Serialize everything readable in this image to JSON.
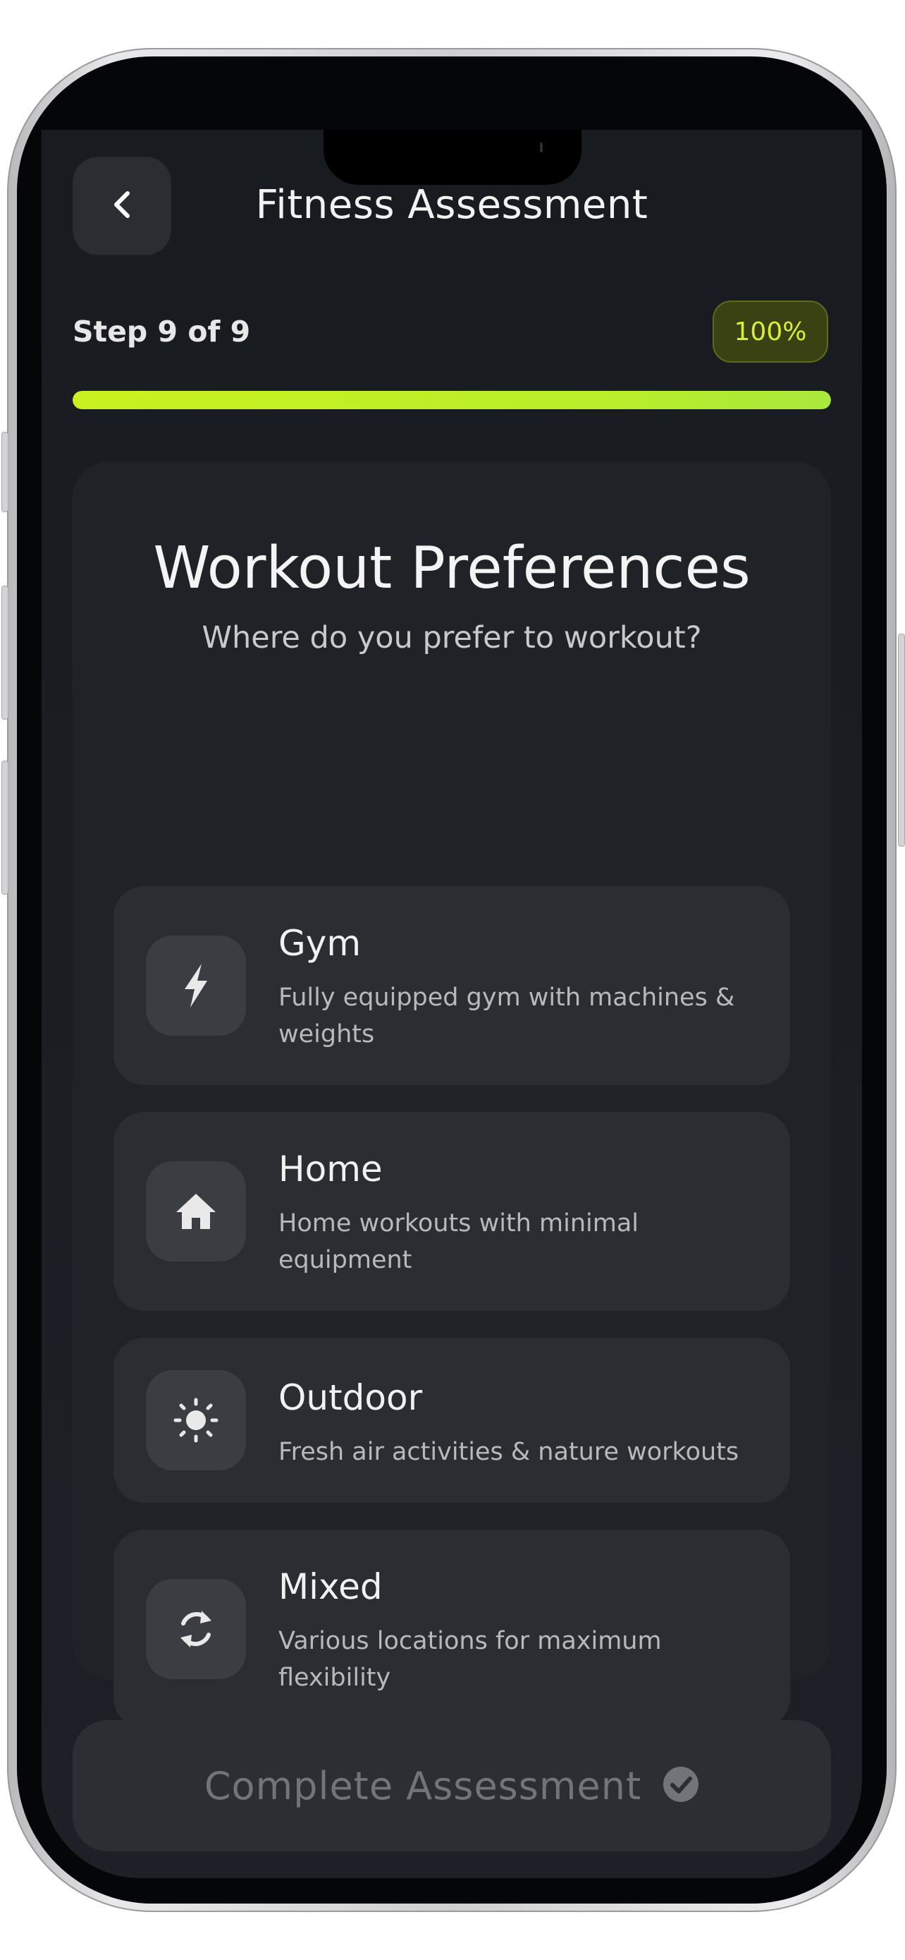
{
  "header": {
    "title": "Fitness Assessment",
    "back_icon": "chevron-left-icon"
  },
  "progress": {
    "step_label": "Step 9 of 9",
    "percent_label": "100%",
    "percent_value": 100
  },
  "card": {
    "title": "Workout Preferences",
    "subtitle": "Where do you prefer to workout?"
  },
  "options": [
    {
      "icon": "lightning-bolt-icon",
      "title": "Gym",
      "description": "Fully equipped gym with machines & weights"
    },
    {
      "icon": "home-icon",
      "title": "Home",
      "description": "Home workouts with minimal equipment"
    },
    {
      "icon": "sun-icon",
      "title": "Outdoor",
      "description": "Fresh air activities & nature workouts"
    },
    {
      "icon": "sync-arrows-icon",
      "title": "Mixed",
      "description": "Various locations for maximum flexibility"
    }
  ],
  "footer": {
    "complete_label": "Complete Assessment",
    "complete_icon": "check-circle-icon",
    "enabled": false
  },
  "colors": {
    "accent": "#c9f11f",
    "background": "#1a1d21",
    "card": "#1f2226",
    "option": "#2a2d31"
  }
}
